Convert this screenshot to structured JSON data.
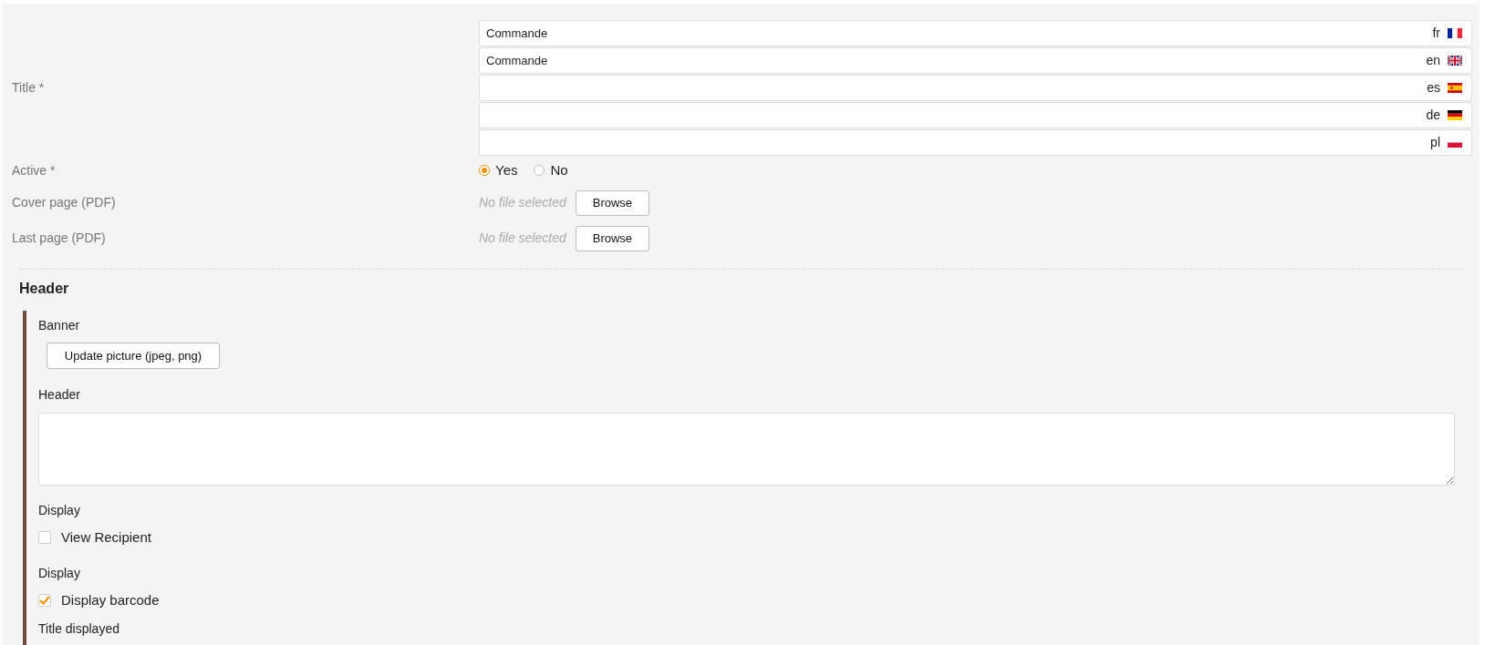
{
  "title_field": {
    "label": "Title *",
    "translations": [
      {
        "value": "Commande",
        "lang": "fr",
        "kind": "france"
      },
      {
        "value": "Commande",
        "lang": "en",
        "kind": "uk"
      },
      {
        "lang": "es",
        "kind": "spain"
      },
      {
        "lang": "de",
        "kind": "germany"
      },
      {
        "lang": "pl",
        "kind": "poland"
      }
    ]
  },
  "active": {
    "label": "Active *",
    "options": [
      {
        "label": "Yes",
        "selected": true
      },
      {
        "label": "No",
        "selected": false
      }
    ]
  },
  "files": [
    {
      "label": "Cover page (PDF)",
      "status": "No file selected",
      "button": "Browse"
    },
    {
      "label": "Last page (PDF)",
      "status": "No file selected",
      "button": "Browse"
    }
  ],
  "header_section": {
    "heading": "Header",
    "banner_label": "Banner",
    "banner_button": "Update picture (jpeg, png)",
    "header_label": "Header",
    "checkboxes": [
      {
        "group_label": "Display",
        "label": "View Recipient",
        "checked": false
      },
      {
        "group_label": "Display",
        "label": "Display barcode",
        "checked": true
      }
    ],
    "title_displayed_label": "Title displayed"
  }
}
